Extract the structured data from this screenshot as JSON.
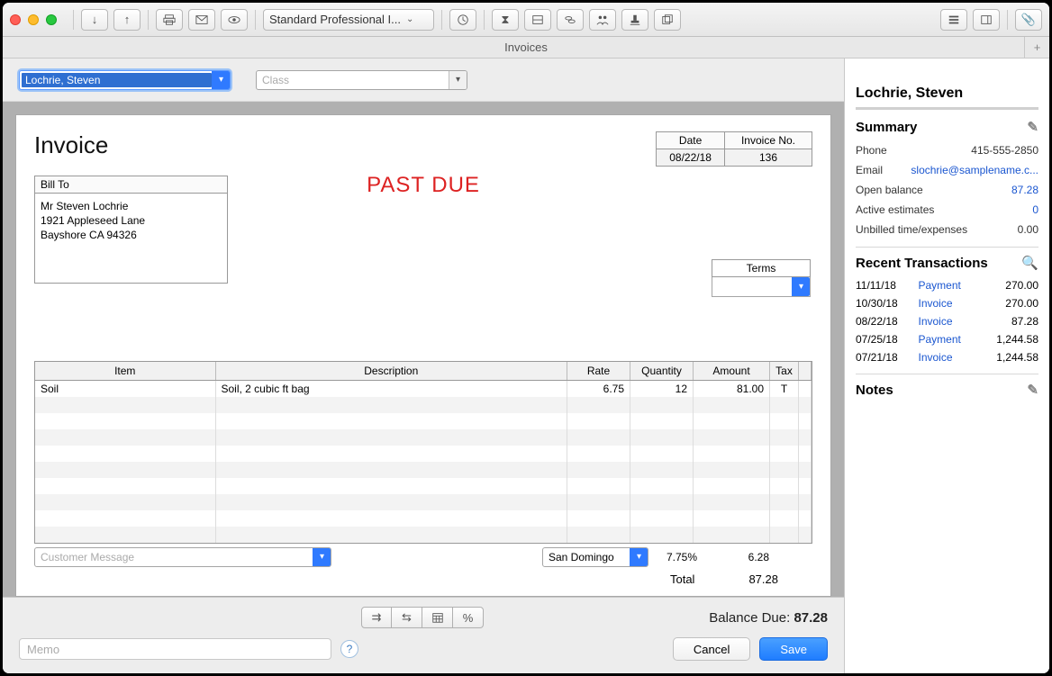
{
  "toolbar": {
    "template_label": "Standard Professional I..."
  },
  "window_title": "Invoices",
  "customer_select": "Lochrie, Steven",
  "class_placeholder": "Class",
  "invoice": {
    "title": "Invoice",
    "watermark": "PAST DUE",
    "date_label": "Date",
    "date_value": "08/22/18",
    "invno_label": "Invoice No.",
    "invno_value": "136",
    "billto_label": "Bill To",
    "billto_lines": [
      "Mr Steven Lochrie",
      "1921 Appleseed Lane",
      "Bayshore CA 94326"
    ],
    "terms_label": "Terms",
    "headers": {
      "item": "Item",
      "desc": "Description",
      "rate": "Rate",
      "qty": "Quantity",
      "amount": "Amount",
      "tax": "Tax"
    },
    "line": {
      "item": "Soil",
      "desc": "Soil, 2 cubic ft bag",
      "rate": "6.75",
      "qty": "12",
      "amount": "81.00",
      "tax": "T"
    },
    "cust_msg_placeholder": "Customer Message",
    "tax_jur": "San Domingo",
    "tax_pct": "7.75%",
    "tax_amt": "6.28",
    "total_label": "Total",
    "total_value": "87.28"
  },
  "footer": {
    "balance_label": "Balance Due:",
    "balance_value": "87.28",
    "memo_placeholder": "Memo",
    "cancel": "Cancel",
    "save": "Save"
  },
  "panel": {
    "name": "Lochrie, Steven",
    "summary_hd": "Summary",
    "phone_lbl": "Phone",
    "phone_val": "415-555-2850",
    "email_lbl": "Email",
    "email_val": "slochrie@samplename.c...",
    "open_lbl": "Open balance",
    "open_val": "87.28",
    "active_lbl": "Active estimates",
    "active_val": "0",
    "unbilled_lbl": "Unbilled time/expenses",
    "unbilled_val": "0.00",
    "recent_hd": "Recent Transactions",
    "tx": [
      {
        "d": "11/11/18",
        "t": "Payment",
        "a": "270.00"
      },
      {
        "d": "10/30/18",
        "t": "Invoice",
        "a": "270.00"
      },
      {
        "d": "08/22/18",
        "t": "Invoice",
        "a": "87.28"
      },
      {
        "d": "07/25/18",
        "t": "Payment",
        "a": "1,244.58"
      },
      {
        "d": "07/21/18",
        "t": "Invoice",
        "a": "1,244.58"
      }
    ],
    "notes_hd": "Notes"
  }
}
